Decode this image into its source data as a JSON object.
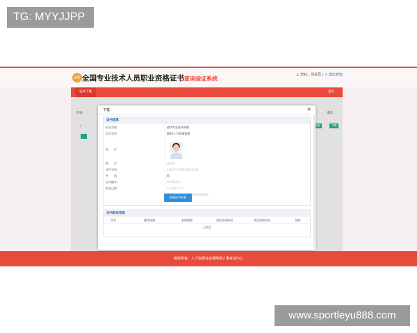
{
  "watermark_top": "TG: MYYJJPP",
  "watermark_bottom": "www.sportleyu888.com",
  "header": {
    "logo_text": "资格",
    "title": "全国专业技术人员职业资格证书",
    "subtitle": "查询验证系统",
    "user_text": "您好，测试员",
    "logout_text": "退出查询"
  },
  "nav": {
    "active_tab": "证书下载",
    "right_link": "首页"
  },
  "background_table": {
    "left_header": "序号",
    "right_header": "操作",
    "row_num": "1",
    "view_button": "查看",
    "download_button": "下载"
  },
  "modal": {
    "title": "下载",
    "close_icon": "×",
    "section1_title": "证书信息",
    "fields": [
      {
        "key": "职业资格：",
        "value": "经济专业技术资格",
        "dim": false
      },
      {
        "key": "证书名称：",
        "value": "级别/人力资源管理",
        "dim": false
      },
      {
        "key": "照　　片：",
        "value": "",
        "dim": false
      },
      {
        "key": "姓　　名：",
        "value": "测试员",
        "dim": true
      },
      {
        "key": "证件号码：",
        "value": "110101199001011234",
        "dim": true
      },
      {
        "key": "性　　别：",
        "value": "男",
        "dim": false
      },
      {
        "key": "证书编号：",
        "value": "20230011",
        "dim": true
      },
      {
        "key": "批准日期：",
        "value": "2023年11月",
        "dim": true
      },
      {
        "key": "",
        "value": "签发单位：人力资源和社会保障部",
        "dim": true
      }
    ],
    "apply_button": "申请证书补发",
    "section2_title": "证书验证信息",
    "table_headers": [
      "序号",
      "使用场景",
      "有效期限",
      "验证申请时间",
      "验证完成时间",
      "操作"
    ],
    "empty_text": "无数据"
  },
  "footer": "版权所有：人力资源社会保障部人事考试中心"
}
